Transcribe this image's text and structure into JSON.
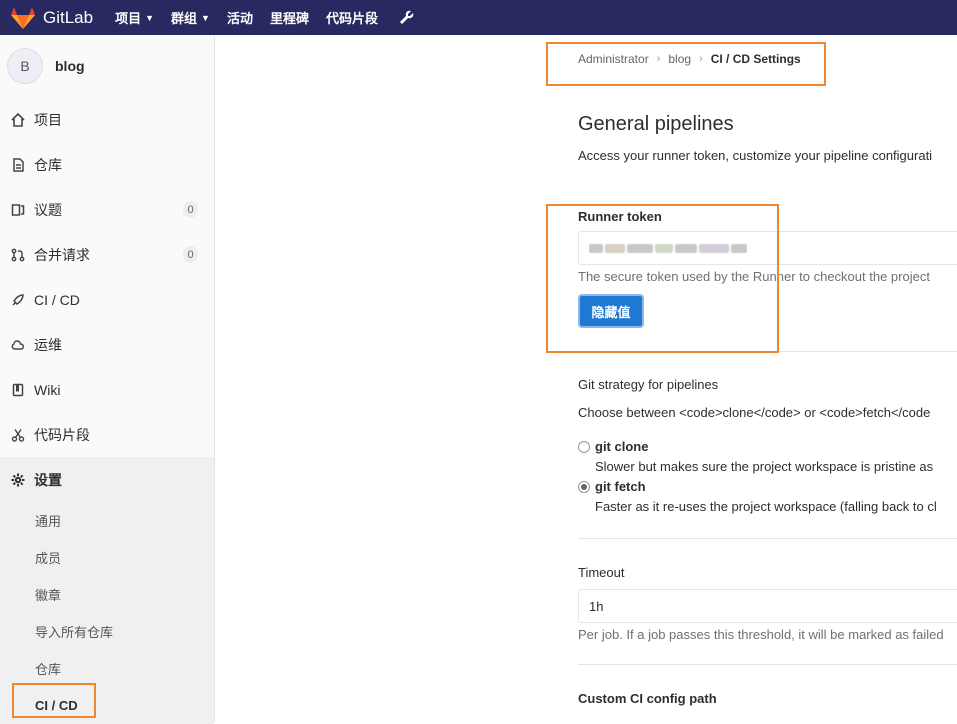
{
  "topbar": {
    "logo_text": "GitLab",
    "nav": [
      {
        "label": "项目",
        "dropdown": true
      },
      {
        "label": "群组",
        "dropdown": true
      },
      {
        "label": "活动",
        "dropdown": false
      },
      {
        "label": "里程碑",
        "dropdown": false
      },
      {
        "label": "代码片段",
        "dropdown": false
      }
    ]
  },
  "sidebar": {
    "avatar_letter": "B",
    "project_name": "blog",
    "items": [
      {
        "label": "项目",
        "icon": "home-icon"
      },
      {
        "label": "仓库",
        "icon": "repo-icon"
      },
      {
        "label": "议题",
        "icon": "issues-icon",
        "count": "0"
      },
      {
        "label": "合并请求",
        "icon": "merge-request-icon",
        "count": "0"
      },
      {
        "label": "CI / CD",
        "icon": "rocket-icon"
      },
      {
        "label": "运维",
        "icon": "cloud-icon"
      },
      {
        "label": "Wiki",
        "icon": "book-icon"
      },
      {
        "label": "代码片段",
        "icon": "scissors-icon"
      }
    ],
    "settings_label": "设置",
    "settings_sub": [
      "通用",
      "成员",
      "徽章",
      "导入所有仓库",
      "仓库",
      "CI / CD"
    ]
  },
  "breadcrumb": {
    "root": "Administrator",
    "project": "blog",
    "current": "CI / CD Settings"
  },
  "general": {
    "title": "General pipelines",
    "description": "Access your runner token, customize your pipeline configurati"
  },
  "runner": {
    "label": "Runner token",
    "help": "The secure token used by the Runner to checkout the project",
    "button": "隐藏值"
  },
  "git_strategy": {
    "label": "Git strategy for pipelines",
    "description": "Choose between <code>clone</code> or <code>fetch</code",
    "options": [
      {
        "title": "git clone",
        "desc": "Slower but makes sure the project workspace is pristine as",
        "selected": false
      },
      {
        "title": "git fetch",
        "desc": "Faster as it re-uses the project workspace (falling back to cl",
        "selected": true
      }
    ]
  },
  "timeout": {
    "label": "Timeout",
    "value": "1h",
    "help": "Per job. If a job passes this threshold, it will be marked as failed"
  },
  "next_section_label": "Custom CI config path",
  "colors": {
    "topbar": "#292961",
    "accent_button": "#1f78d1",
    "highlight": "#f0872e"
  }
}
